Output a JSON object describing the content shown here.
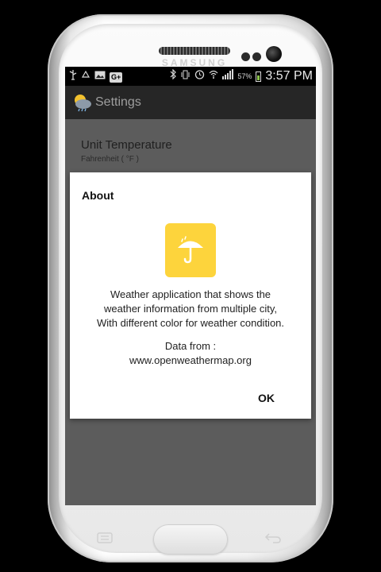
{
  "device": {
    "brand": "SAMSUNG"
  },
  "statusbar": {
    "left_icons": [
      "usb-icon",
      "recycle-icon",
      "image-icon",
      "google-plus-icon"
    ],
    "google_plus_text": "G+",
    "right_icons": [
      "bluetooth-icon",
      "vibrate-icon",
      "alarm-icon",
      "wifi-icon",
      "signal-icon"
    ],
    "battery_percent": "57%",
    "time": "3:57 PM"
  },
  "actionbar": {
    "title": "Settings",
    "icon": "weather-app-icon"
  },
  "preference": {
    "title": "Unit Temperature",
    "summary": "Fahrenheit ( °F )"
  },
  "dialog": {
    "title": "About",
    "icon": "umbrella-icon",
    "icon_color": "#fdd43c",
    "description_lines": [
      "Weather application that shows the",
      "weather information from multiple city,",
      "With different color for weather condition."
    ],
    "data_from_label": "Data from :",
    "data_from_url": "www.openweathermap.org",
    "ok_label": "OK"
  },
  "hardware_keys": [
    "menu-key-icon",
    "home-button",
    "back-key-icon"
  ]
}
